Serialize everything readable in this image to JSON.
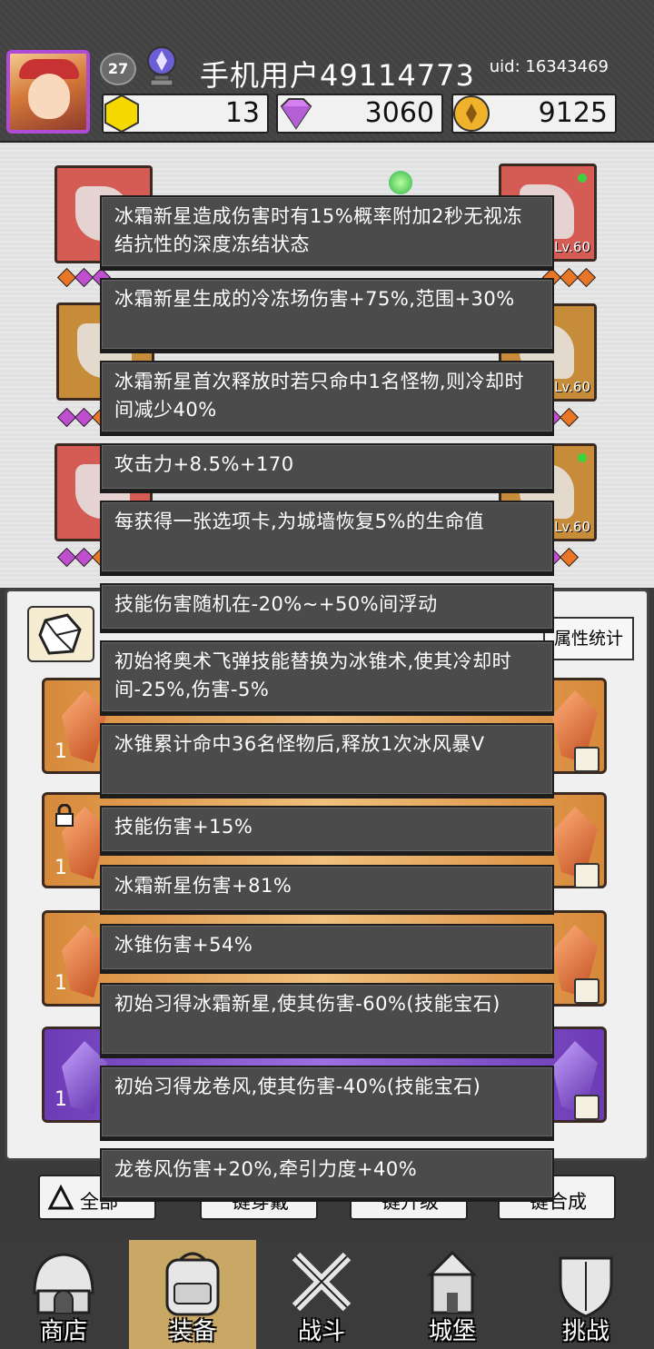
{
  "header": {
    "level": "27",
    "player_name": "手机用户49114773",
    "uid": "uid: 16343469",
    "currencies": [
      {
        "icon": "gold-hexagon-gem-icon",
        "value": "13",
        "color": "#f2d400"
      },
      {
        "icon": "purple-diamond-icon",
        "value": "3060",
        "color": "#c46be0"
      },
      {
        "icon": "gold-coin-icon",
        "value": "9125",
        "color": "#e5a020"
      }
    ]
  },
  "slots": {
    "levels": [
      "Lv.60",
      "Lv.60",
      "Lv.60"
    ]
  },
  "bag": {
    "stats_button": "属性统计",
    "row_counts": [
      "1",
      "1",
      "1",
      "1"
    ]
  },
  "actions": {
    "all_label": "全部",
    "b2": "一键穿戴",
    "b3": "一键升级",
    "b4": "一键合成"
  },
  "nav": {
    "items": [
      "商店",
      "装备",
      "战斗",
      "城堡",
      "挑战"
    ],
    "active": "装备"
  },
  "tooltips": [
    "冰霜新星造成伤害时有15%概率附加2秒无视冻结抗性的深度冻结状态",
    "冰霜新星生成的冷冻场伤害+75%,范围+30%",
    "冰霜新星首次释放时若只命中1名怪物,则冷却时间减少40%",
    "攻击力+8.5%+170",
    "每获得一张选项卡,为城墙恢复5%的生命值",
    "技能伤害随机在-20%~+50%间浮动",
    "初始将奥术飞弹技能替换为冰锥术,使其冷却时间-25%,伤害-5%",
    "冰锥累计命中36名怪物后,释放1次冰风暴V",
    "技能伤害+15%",
    "冰霜新星伤害+81%",
    "冰锥伤害+54%",
    "初始习得冰霜新星,使其伤害-60%(技能宝石)",
    "初始习得龙卷风,使其伤害-40%(技能宝石)",
    "龙卷风伤害+20%,牵引力度+40%"
  ]
}
